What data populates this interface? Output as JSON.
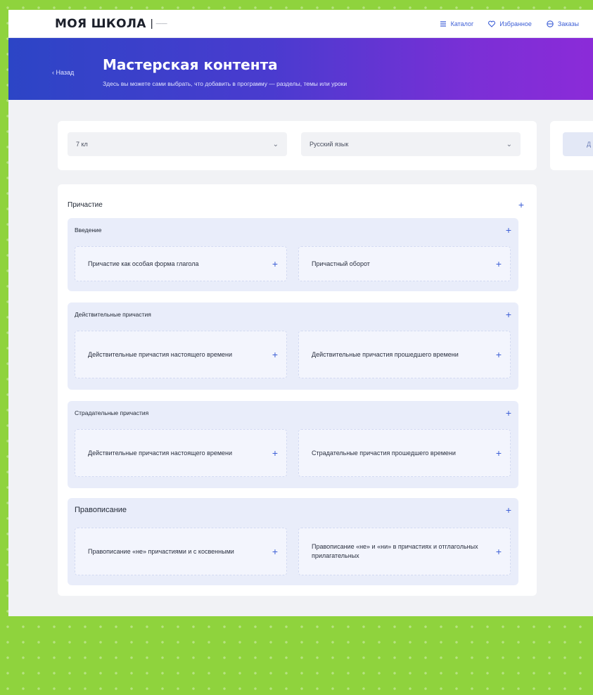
{
  "header": {
    "logo": "МОЯ ШКОЛА",
    "logo_sep": "|",
    "logo_sub": "——",
    "nav": [
      {
        "label": "Каталог",
        "icon": "list-icon"
      },
      {
        "label": "Избранное",
        "icon": "heart-icon"
      },
      {
        "label": "Заказы",
        "icon": "box-icon"
      }
    ]
  },
  "hero": {
    "back": "‹ Назад",
    "title": "Мастерская контента",
    "subtitle": "Здесь вы можете сами выбрать, что добавить в программу — разделы, темы или уроки"
  },
  "filters": {
    "grade": "7 кл",
    "subject": "Русский язык",
    "chevron": "⌄",
    "action": "Д"
  },
  "content": {
    "title": "Причастие",
    "plus": "+",
    "groups": [
      {
        "title": "Введение",
        "items": [
          "Причастие как особая форма глагола",
          "Причастный оборот"
        ]
      },
      {
        "title": "Действительные причастия",
        "items": [
          "Действительные причастия настоящего времени",
          "Действительные причастия прошедшего времени"
        ]
      },
      {
        "title": "Страдательные причастия",
        "items": [
          "Действительные причастия настоящего времени",
          "Страдательные причастия прошедшего времени"
        ]
      },
      {
        "title": "Правописание",
        "items": [
          "Правописание «не» причастиями и с косвенными",
          "Правописание «не» и «ни» в причастиях и отглагольных прилагательных"
        ]
      }
    ]
  },
  "colors": {
    "accent": "#3d5fd6",
    "hero_start": "#2c45c6",
    "hero_end": "#8b2bd8",
    "frame_green": "#8fd33d"
  }
}
